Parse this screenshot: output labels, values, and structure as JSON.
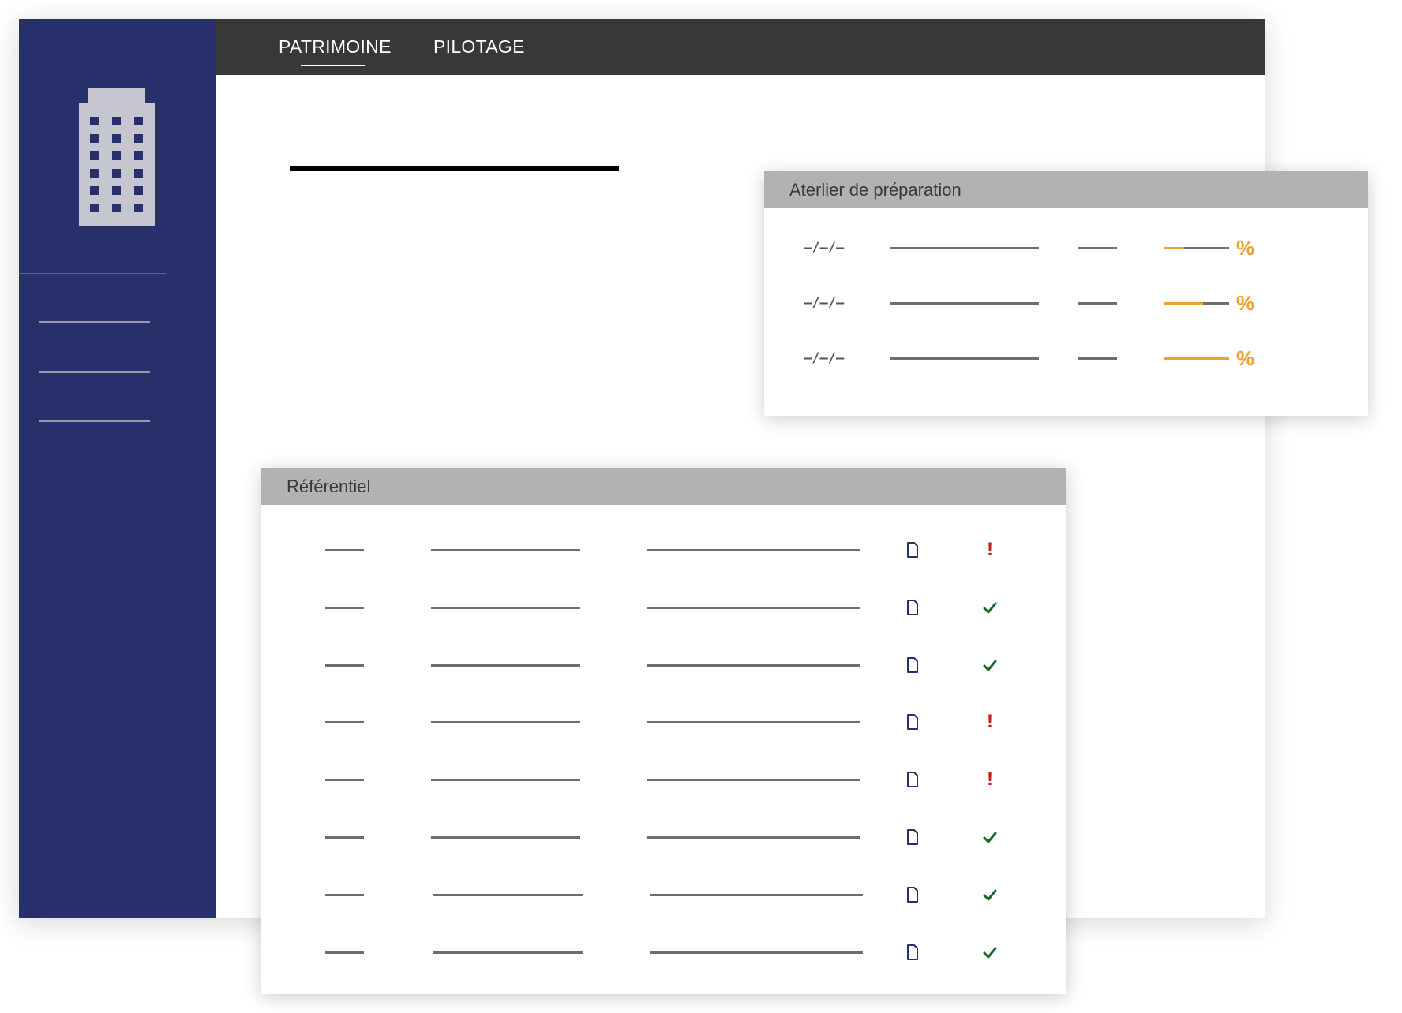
{
  "nav": {
    "tabs": [
      {
        "label": "PATRIMOINE",
        "active": true
      },
      {
        "label": "PILOTAGE",
        "active": false
      }
    ]
  },
  "sidebar": {
    "logo_icon": "building-icon",
    "item_count_visible": 3
  },
  "atelier": {
    "title": "Aterlier de préparation",
    "rows": [
      {
        "date_placeholder": "–/–/–",
        "progress": 0.3
      },
      {
        "date_placeholder": "–/–/–",
        "progress": 0.6
      },
      {
        "date_placeholder": "–/–/–",
        "progress": 1.0
      }
    ],
    "percent_icon": "percent-icon",
    "accent_color": "#f0a030"
  },
  "referentiel": {
    "title": "Référentiel",
    "rows": [
      {
        "status": "warning"
      },
      {
        "status": "ok"
      },
      {
        "status": "ok"
      },
      {
        "status": "warning"
      },
      {
        "status": "warning"
      },
      {
        "status": "ok"
      },
      {
        "status": "ok"
      },
      {
        "status": "ok"
      }
    ],
    "document_icon": "document-icon",
    "status_colors": {
      "ok": "#1a6a30",
      "warning": "#c21f1f"
    }
  },
  "colors": {
    "sidebar": "#27306a",
    "topbar": "#383836",
    "panel_header": "#b2b2b2",
    "doc_icon": "#27306a"
  }
}
